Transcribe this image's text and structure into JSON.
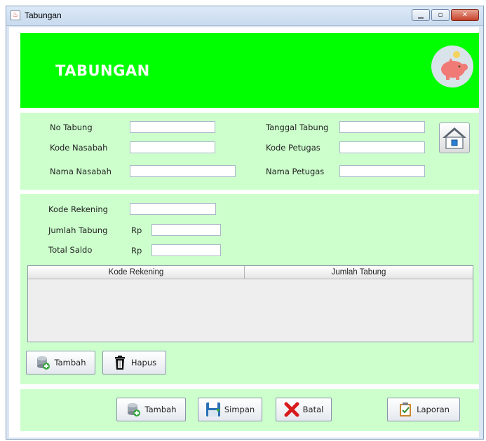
{
  "window": {
    "title": "Tabungan",
    "buttons": [
      "minimize",
      "maximize",
      "close"
    ]
  },
  "header": {
    "title": "TABUNGAN",
    "icon": "piggy-bank-icon",
    "bg_color": "#00ff00"
  },
  "form": {
    "no_tabung": {
      "label": "No Tabung",
      "value": ""
    },
    "kode_nasabah": {
      "label": "Kode Nasabah",
      "value": ""
    },
    "nama_nasabah": {
      "label": "Nama Nasabah",
      "value": ""
    },
    "tanggal_tabung": {
      "label": "Tanggal Tabung",
      "value": ""
    },
    "kode_petugas": {
      "label": "Kode Petugas",
      "value": ""
    },
    "nama_petugas": {
      "label": "Nama Petugas",
      "value": ""
    },
    "home_icon": "home-icon"
  },
  "detail": {
    "kode_rekening": {
      "label": "Kode Rekening",
      "value": ""
    },
    "jumlah_tabung": {
      "label": "Jumlah Tabung",
      "prefix": "Rp",
      "value": ""
    },
    "total_saldo": {
      "label": "Total Saldo",
      "prefix": "Rp",
      "value": ""
    },
    "table": {
      "columns": [
        "Kode Rekening",
        "Jumlah Tabung"
      ],
      "rows": []
    },
    "buttons": {
      "tambah": "Tambah",
      "hapus": "Hapus"
    }
  },
  "footer": {
    "tambah": "Tambah",
    "simpan": "Simpan",
    "batal": "Batal",
    "laporan": "Laporan"
  },
  "colors": {
    "panel": "#ccffcc",
    "header": "#00ff00"
  }
}
